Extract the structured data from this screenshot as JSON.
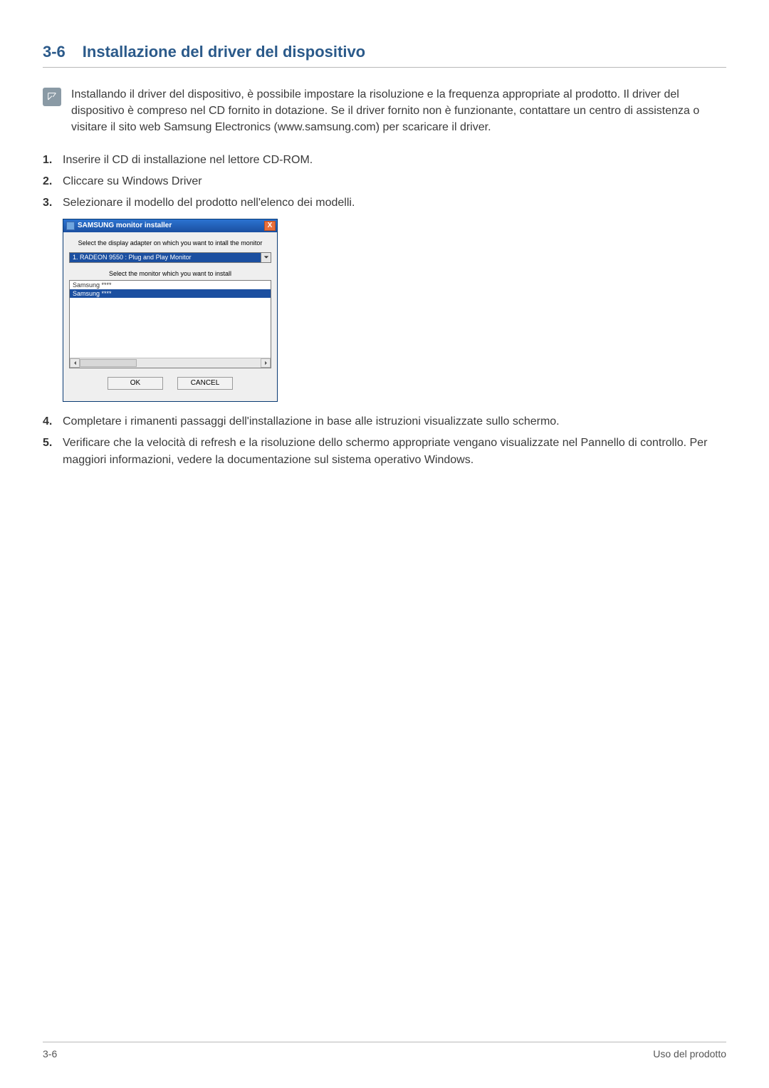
{
  "heading": {
    "number": "3-6",
    "title": "Installazione del driver del dispositivo"
  },
  "note": {
    "text": "Installando il driver del dispositivo, è possibile impostare la risoluzione e la frequenza appropriate al prodotto. Il driver del dispositivo è compreso nel CD fornito in dotazione. Se il driver fornito non è funzionante, contattare un centro di assistenza o visitare il sito web Samsung Electronics (www.samsung.com) per scaricare il driver."
  },
  "steps": {
    "s1": "Inserire il CD di installazione nel lettore CD-ROM.",
    "s2": "Cliccare su Windows Driver",
    "s3": "Selezionare il modello del prodotto nell'elenco dei modelli.",
    "s4": "Completare i rimanenti passaggi dell'installazione in base alle istruzioni visualizzate sullo schermo.",
    "s5": "Verificare che la velocità di refresh e la risoluzione dello schermo appropriate vengano visualizzate nel Pannello di controllo. Per maggiori informazioni, vedere la documentazione sul sistema operativo Windows."
  },
  "dialog": {
    "title": "SAMSUNG monitor installer",
    "close": "X",
    "label1": "Select the display adapter on which you want to intall the monitor",
    "select_value": "1. RADEON 9550 : Plug and Play Monitor",
    "label2": "Select the monitor which you want to install",
    "list": {
      "item0": "Samsung ****",
      "item1": "Samsung ****"
    },
    "ok": "OK",
    "cancel": "CANCEL"
  },
  "footer": {
    "left": "3-6",
    "right": "Uso del prodotto"
  }
}
